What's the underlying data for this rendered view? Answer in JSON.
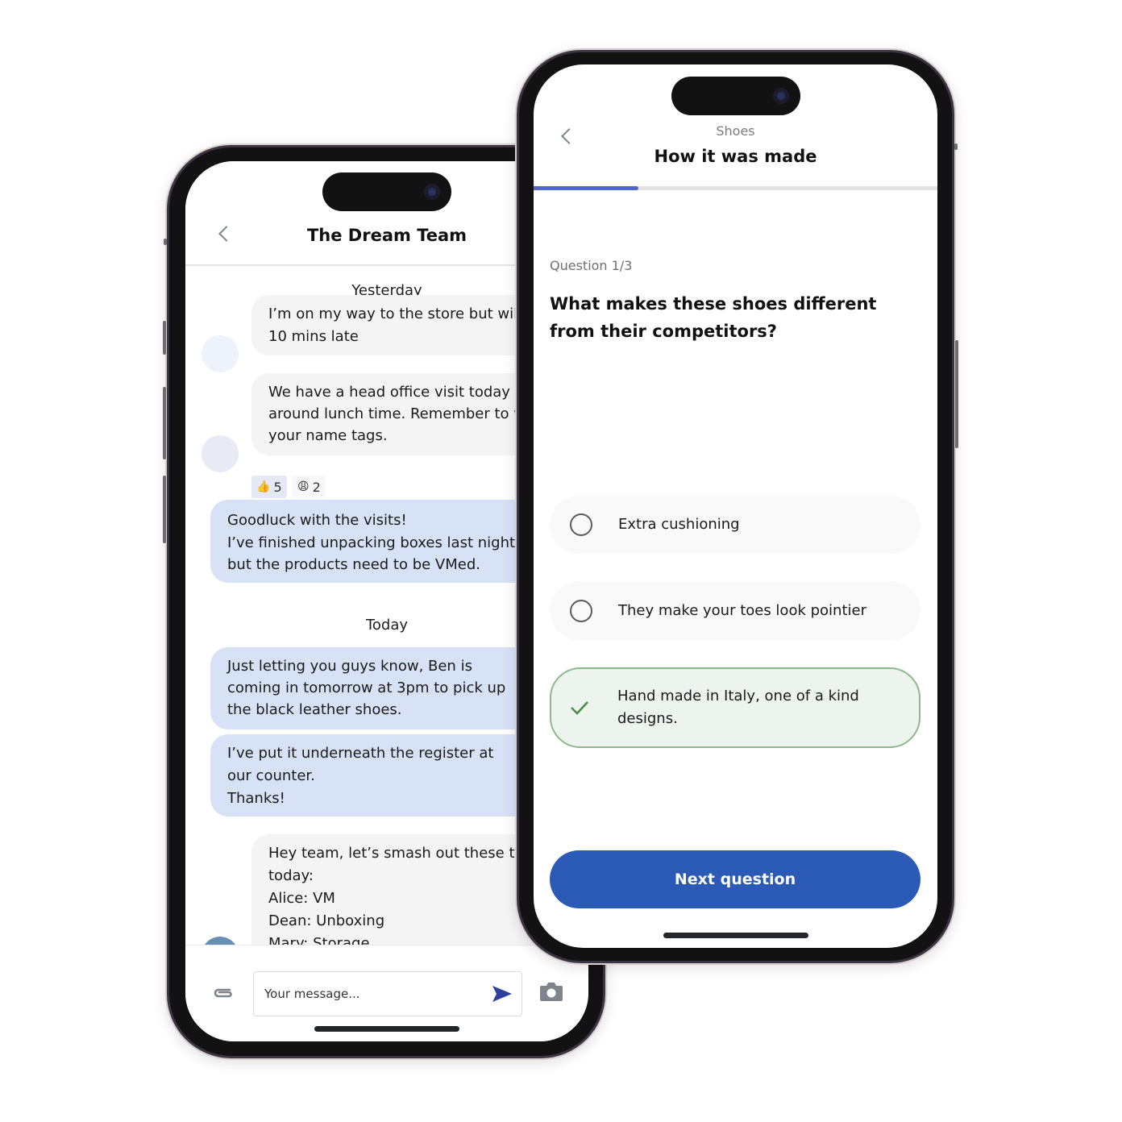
{
  "chat": {
    "title": "The Dream Team",
    "messages_day_1_label": "Yesterday",
    "messages_day_2_label": "Today",
    "messages": [
      {
        "direction": "incoming",
        "lines": [
          "I’m on my way to the store but will",
          "10 mins late"
        ]
      },
      {
        "direction": "incoming",
        "lines": [
          "We have a head office visit today",
          "around lunch time. Remember to wear",
          "your name tags."
        ],
        "reactions": [
          {
            "emoji": "👍",
            "count": "5"
          },
          {
            "emoji": "😩",
            "count": "2"
          }
        ]
      },
      {
        "direction": "outgoing",
        "lines": [
          "Goodluck with the visits!",
          "I’ve finished unpacking boxes last night",
          "but the products need to be VMed."
        ]
      },
      {
        "direction": "outgoing",
        "lines": [
          "Just letting you guys know, Ben is",
          "coming in tomorrow at 3pm to pick up",
          "the black leather shoes."
        ]
      },
      {
        "direction": "outgoing",
        "lines": [
          "I’ve put it underneath the register at",
          "our counter.",
          "Thanks!"
        ]
      },
      {
        "direction": "incoming",
        "lines": [
          "Hey team, let’s smash out these tasks",
          "today:",
          "Alice: VM",
          "Dean: Unboxing",
          "Mary: Storage"
        ]
      }
    ],
    "composer": {
      "placeholder": "Your message...",
      "attach_icon": "paperclip-icon",
      "send_icon": "send-icon",
      "camera_icon": "camera-icon"
    }
  },
  "quiz": {
    "breadcrumb": "Shoes",
    "title": "How it was made",
    "progress_fraction": 0.26,
    "question_counter": "Question 1/3",
    "question": "What makes these shoes different from their competitors?",
    "options": [
      {
        "label": "Extra cushioning",
        "state": "unselected"
      },
      {
        "label": "They make your toes look pointier",
        "state": "unselected"
      },
      {
        "label": "Hand made in Italy, one of a kind designs.",
        "state": "correct"
      }
    ],
    "next_button": "Next question"
  },
  "colors": {
    "accent_blue": "#2b59b6",
    "progress_blue": "#5467c7",
    "outgoing_bubble": "#d8e2f6",
    "incoming_bubble": "#f4f4f4",
    "correct_border": "#8db98d",
    "correct_fill": "#edf4ed",
    "send_icon": "#2c3e9e"
  }
}
